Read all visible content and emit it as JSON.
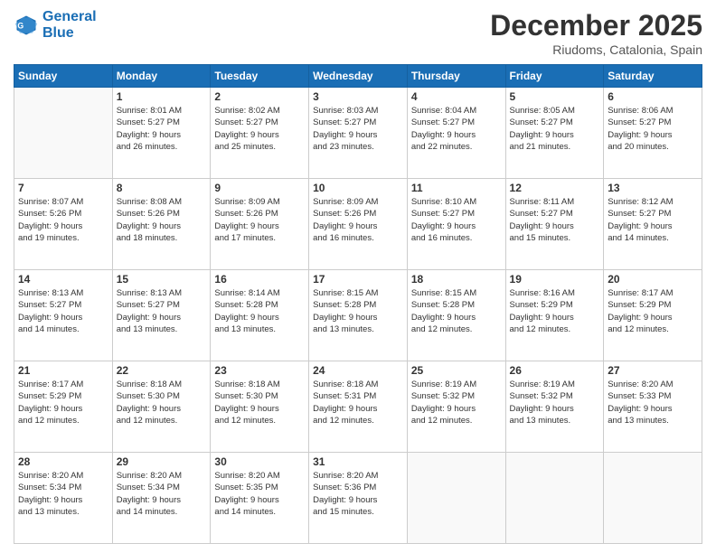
{
  "header": {
    "logo_line1": "General",
    "logo_line2": "Blue",
    "month_title": "December 2025",
    "location": "Riudoms, Catalonia, Spain"
  },
  "days_of_week": [
    "Sunday",
    "Monday",
    "Tuesday",
    "Wednesday",
    "Thursday",
    "Friday",
    "Saturday"
  ],
  "weeks": [
    [
      {
        "day": "",
        "info": ""
      },
      {
        "day": "1",
        "info": "Sunrise: 8:01 AM\nSunset: 5:27 PM\nDaylight: 9 hours\nand 26 minutes."
      },
      {
        "day": "2",
        "info": "Sunrise: 8:02 AM\nSunset: 5:27 PM\nDaylight: 9 hours\nand 25 minutes."
      },
      {
        "day": "3",
        "info": "Sunrise: 8:03 AM\nSunset: 5:27 PM\nDaylight: 9 hours\nand 23 minutes."
      },
      {
        "day": "4",
        "info": "Sunrise: 8:04 AM\nSunset: 5:27 PM\nDaylight: 9 hours\nand 22 minutes."
      },
      {
        "day": "5",
        "info": "Sunrise: 8:05 AM\nSunset: 5:27 PM\nDaylight: 9 hours\nand 21 minutes."
      },
      {
        "day": "6",
        "info": "Sunrise: 8:06 AM\nSunset: 5:27 PM\nDaylight: 9 hours\nand 20 minutes."
      }
    ],
    [
      {
        "day": "7",
        "info": "Sunrise: 8:07 AM\nSunset: 5:26 PM\nDaylight: 9 hours\nand 19 minutes."
      },
      {
        "day": "8",
        "info": "Sunrise: 8:08 AM\nSunset: 5:26 PM\nDaylight: 9 hours\nand 18 minutes."
      },
      {
        "day": "9",
        "info": "Sunrise: 8:09 AM\nSunset: 5:26 PM\nDaylight: 9 hours\nand 17 minutes."
      },
      {
        "day": "10",
        "info": "Sunrise: 8:09 AM\nSunset: 5:26 PM\nDaylight: 9 hours\nand 16 minutes."
      },
      {
        "day": "11",
        "info": "Sunrise: 8:10 AM\nSunset: 5:27 PM\nDaylight: 9 hours\nand 16 minutes."
      },
      {
        "day": "12",
        "info": "Sunrise: 8:11 AM\nSunset: 5:27 PM\nDaylight: 9 hours\nand 15 minutes."
      },
      {
        "day": "13",
        "info": "Sunrise: 8:12 AM\nSunset: 5:27 PM\nDaylight: 9 hours\nand 14 minutes."
      }
    ],
    [
      {
        "day": "14",
        "info": "Sunrise: 8:13 AM\nSunset: 5:27 PM\nDaylight: 9 hours\nand 14 minutes."
      },
      {
        "day": "15",
        "info": "Sunrise: 8:13 AM\nSunset: 5:27 PM\nDaylight: 9 hours\nand 13 minutes."
      },
      {
        "day": "16",
        "info": "Sunrise: 8:14 AM\nSunset: 5:28 PM\nDaylight: 9 hours\nand 13 minutes."
      },
      {
        "day": "17",
        "info": "Sunrise: 8:15 AM\nSunset: 5:28 PM\nDaylight: 9 hours\nand 13 minutes."
      },
      {
        "day": "18",
        "info": "Sunrise: 8:15 AM\nSunset: 5:28 PM\nDaylight: 9 hours\nand 12 minutes."
      },
      {
        "day": "19",
        "info": "Sunrise: 8:16 AM\nSunset: 5:29 PM\nDaylight: 9 hours\nand 12 minutes."
      },
      {
        "day": "20",
        "info": "Sunrise: 8:17 AM\nSunset: 5:29 PM\nDaylight: 9 hours\nand 12 minutes."
      }
    ],
    [
      {
        "day": "21",
        "info": "Sunrise: 8:17 AM\nSunset: 5:29 PM\nDaylight: 9 hours\nand 12 minutes."
      },
      {
        "day": "22",
        "info": "Sunrise: 8:18 AM\nSunset: 5:30 PM\nDaylight: 9 hours\nand 12 minutes."
      },
      {
        "day": "23",
        "info": "Sunrise: 8:18 AM\nSunset: 5:30 PM\nDaylight: 9 hours\nand 12 minutes."
      },
      {
        "day": "24",
        "info": "Sunrise: 8:18 AM\nSunset: 5:31 PM\nDaylight: 9 hours\nand 12 minutes."
      },
      {
        "day": "25",
        "info": "Sunrise: 8:19 AM\nSunset: 5:32 PM\nDaylight: 9 hours\nand 12 minutes."
      },
      {
        "day": "26",
        "info": "Sunrise: 8:19 AM\nSunset: 5:32 PM\nDaylight: 9 hours\nand 13 minutes."
      },
      {
        "day": "27",
        "info": "Sunrise: 8:20 AM\nSunset: 5:33 PM\nDaylight: 9 hours\nand 13 minutes."
      }
    ],
    [
      {
        "day": "28",
        "info": "Sunrise: 8:20 AM\nSunset: 5:34 PM\nDaylight: 9 hours\nand 13 minutes."
      },
      {
        "day": "29",
        "info": "Sunrise: 8:20 AM\nSunset: 5:34 PM\nDaylight: 9 hours\nand 14 minutes."
      },
      {
        "day": "30",
        "info": "Sunrise: 8:20 AM\nSunset: 5:35 PM\nDaylight: 9 hours\nand 14 minutes."
      },
      {
        "day": "31",
        "info": "Sunrise: 8:20 AM\nSunset: 5:36 PM\nDaylight: 9 hours\nand 15 minutes."
      },
      {
        "day": "",
        "info": ""
      },
      {
        "day": "",
        "info": ""
      },
      {
        "day": "",
        "info": ""
      }
    ]
  ]
}
